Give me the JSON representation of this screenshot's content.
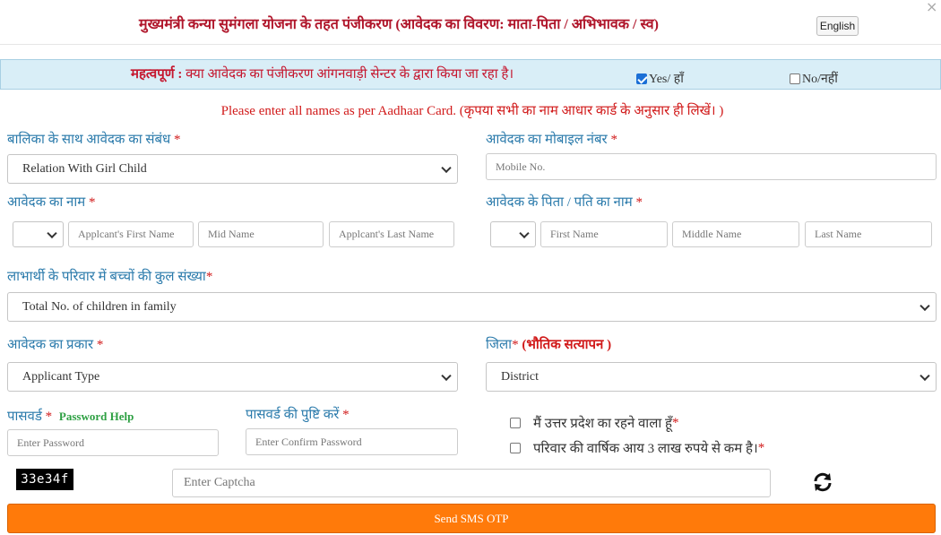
{
  "header": {
    "title": "मुख्यमंत्री कन्या सुमंगला योजना के तहत पंजीकरण (आवेदक का विवरण: माता-पिता / अभिभावक / स्व)",
    "language_button": "English",
    "close_icon": "×"
  },
  "notice": {
    "label": "महत्वपूर्ण :",
    "text": "क्या आवेदक का पंजीकरण आंगनवाड़ी सेन्टर के द्वारा किया जा रहा है।",
    "yes_label": "Yes/ हाँ",
    "yes_checked": true,
    "no_label": "No/नहीं",
    "no_checked": false
  },
  "aadhaar_note": "Please enter all names as per Aadhaar Card. (कृपया सभी का नाम आधार कार्ड के अनुसार ही लिखें। )",
  "form": {
    "relation": {
      "label": "बालिका के साथ आवेदक का संबंध",
      "value": "Relation With Girl Child"
    },
    "mobile": {
      "label": "आवेदक का मोबाइल नंबर",
      "placeholder": "Mobile No."
    },
    "applicant_name": {
      "label": "आवेदक का नाम",
      "first_placeholder": "Applcant's First Name",
      "mid_placeholder": "Mid Name",
      "last_placeholder": "Applcant's Last Name"
    },
    "father_name": {
      "label": "आवेदक के पिता / पति का नाम",
      "first_placeholder": "First Name",
      "mid_placeholder": "Middle Name",
      "last_placeholder": "Last Name"
    },
    "children": {
      "label": "लाभार्थी के परिवार में बच्चों की कुल संख्या",
      "value": "Total No. of children in family"
    },
    "applicant_type": {
      "label": "आवेदक का प्रकार",
      "value": "Applicant Type"
    },
    "district": {
      "label": "जिला",
      "verify": "(भौतिक सत्यापन )",
      "value": "District"
    },
    "password": {
      "label": "पासवर्ड",
      "help": "Password Help",
      "placeholder": "Enter Password"
    },
    "confirm_password": {
      "label": "पासवर्ड की पुष्टि करें",
      "placeholder": "Enter Confirm Password"
    },
    "resident_check": "मैं उत्तर प्रदेश का रहने वाला हूँ",
    "income_check": "परिवार की वार्षिक आय 3 लाख रुपये से कम है।",
    "captcha": {
      "code": "33e34f",
      "placeholder": "Enter Captcha"
    },
    "required_mark": "*"
  },
  "submit_button": "Send SMS OTP",
  "colors": {
    "title_red": "#b0162b",
    "label_blue": "#2a7aab",
    "notice_bg": "#d9eef7",
    "button_orange": "#ff7a0a",
    "help_green": "#2ea043"
  }
}
